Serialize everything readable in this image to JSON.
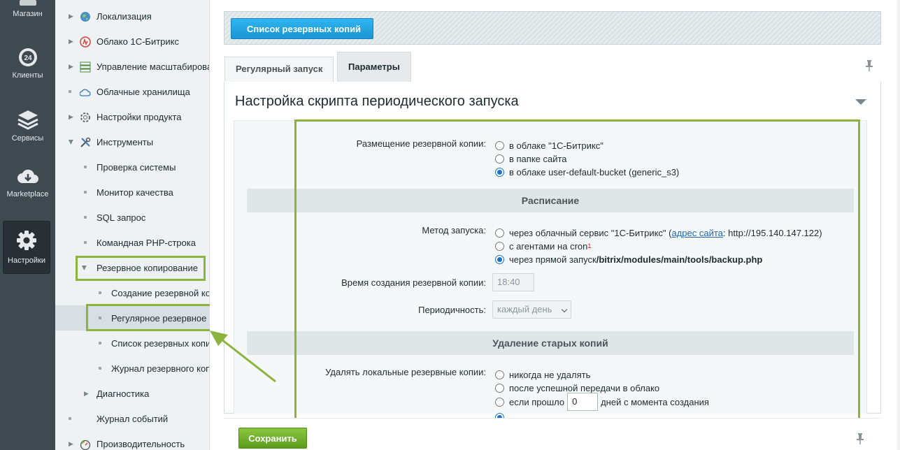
{
  "leftbar": {
    "items": [
      {
        "label": "Магазин",
        "icon": "shop-icon"
      },
      {
        "label": "Клиенты",
        "icon": "clients-24-icon",
        "badge": "24"
      },
      {
        "label": "Сервисы",
        "icon": "layers-icon"
      },
      {
        "label": "Marketplace",
        "icon": "cloud-download-icon"
      },
      {
        "label": "Настройки",
        "icon": "gear-icon"
      }
    ]
  },
  "menu": {
    "items": [
      {
        "label": "Локализация"
      },
      {
        "label": "Облако 1С-Битрикс"
      },
      {
        "label": "Управление масштабирова"
      },
      {
        "label": "Облачные хранилища"
      },
      {
        "label": "Настройки продукта"
      },
      {
        "label": "Инструменты"
      },
      {
        "label": "Проверка системы"
      },
      {
        "label": "Монитор качества"
      },
      {
        "label": "SQL запрос"
      },
      {
        "label": "Командная PHP-строка"
      },
      {
        "label": "Резервное копирование"
      },
      {
        "label": "Создание резервной ко"
      },
      {
        "label": "Регулярное резервное"
      },
      {
        "label": "Список резервных копи"
      },
      {
        "label": "Журнал резервного коп"
      },
      {
        "label": "Диагностика"
      },
      {
        "label": "Журнал событий"
      },
      {
        "label": "Производительность"
      }
    ]
  },
  "toolbar": {
    "backup_list_button": "Список резервных копий"
  },
  "tabs": [
    {
      "label": "Регулярный запуск"
    },
    {
      "label": "Параметры"
    }
  ],
  "panel": {
    "title": "Настройка скрипта периодического запуска",
    "placement": {
      "label": "Размещение резервной копии:",
      "options": [
        "в облаке \"1С-Битрикс\"",
        "в папке сайта",
        "в облаке user-default-bucket (generic_s3)"
      ],
      "selected": 2
    },
    "schedule_header": "Расписание",
    "method": {
      "label": "Метод запуска:",
      "opt1_text": "через облачный сервис \"1С-Битрикс\" (",
      "opt1_link": "адрес сайта",
      "opt1_tail": ": http://195.140.147.122)",
      "opt2_text": "с агентами на cron",
      "opt2_sup": "1",
      "opt3_text": "через прямой запуск ",
      "opt3_bold": "/bitrix/modules/main/tools/backup.php",
      "selected": 2
    },
    "time": {
      "label": "Время создания резервной копии:",
      "value": "18:40"
    },
    "period": {
      "label": "Периодичность:",
      "value": "каждый день"
    },
    "cleanup_header": "Удаление старых копий",
    "cleanup": {
      "label": "Удалять локальные резервные копии:",
      "opt1": "никогда не удалять",
      "opt2": "после успешной передачи в облако",
      "opt3_pre": "если прошло",
      "opt3_value": "0",
      "opt3_post": "дней с момента создания"
    }
  },
  "footer": {
    "save_label": "Сохранить"
  }
}
